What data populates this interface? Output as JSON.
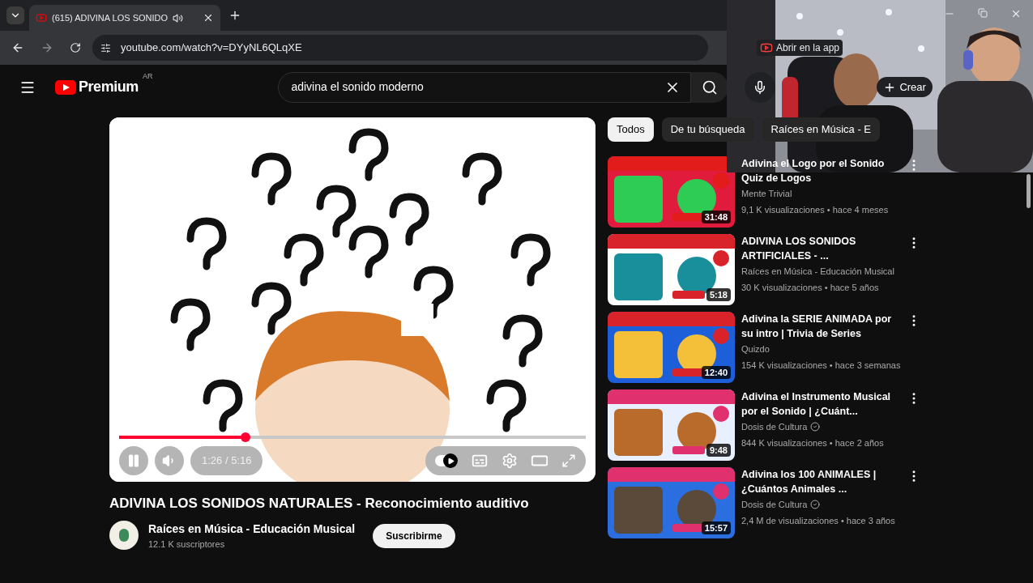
{
  "browser": {
    "tabs": [
      {
        "title": "(615) ADIVINA LOS SONIDO",
        "selected": true,
        "audio": true
      }
    ],
    "url": "youtube.com/watch?v=DYyNL6QLqXE",
    "open_in_app": "Abrir en la app"
  },
  "header": {
    "logo": "Premium",
    "country": "AR",
    "search": {
      "value": "adivina el sonido moderno"
    },
    "create": "Crear"
  },
  "player": {
    "progress": {
      "level": 0.27
    },
    "playing": true,
    "time": "1:26 / 5:16",
    "autoplay": {
      "on": true
    }
  },
  "video": {
    "title": "ADIVINA LOS SONIDOS NATURALES - Reconocimiento auditivo",
    "channel": "Raíces en Música - Educación Musical",
    "subscribers": "12.1 K suscriptores",
    "subscribe": "Suscribirme"
  },
  "chips": [
    {
      "label": "Todos",
      "selected": true
    },
    {
      "label": "De tu búsqueda",
      "selected": false
    },
    {
      "label": "Raíces en Música - E",
      "selected": false
    }
  ],
  "related": [
    {
      "title": "Adivina el Logo por el Sonido Quiz de Logos",
      "channel": "Mente Trivial",
      "verified": false,
      "meta": "9,1 K visualizaciones • hace 4 meses",
      "duration": "31:48",
      "kind": "picture"
    },
    {
      "title": "ADIVINA LOS SONIDOS ARTIFICIALES - ...",
      "channel": "Raíces en Música - Educación Musical",
      "verified": false,
      "meta": "30 K visualizaciones • hace 5 años",
      "duration": "5:18",
      "kind": "picture"
    },
    {
      "title": "Adivina la SERIE ANIMADA por su intro | Trivia de Series",
      "channel": "Quizdo",
      "verified": false,
      "meta": "154 K visualizaciones • hace 3 semanas",
      "duration": "12:40",
      "kind": "picture"
    },
    {
      "title": "Adivina el Instrumento Musical por el Sonido | ¿Cuánt...",
      "channel": "Dosis de Cultura",
      "verified": true,
      "meta": "844 K visualizaciones • hace 2 años",
      "duration": "9:48",
      "kind": "picture"
    },
    {
      "title": "Adivina los 100 ANIMALES | ¿Cuántos Animales ...",
      "channel": "Dosis de Cultura",
      "verified": true,
      "meta": "2,4 M de visualizaciones • hace 3 años",
      "duration": "15:57",
      "kind": "picture"
    }
  ]
}
